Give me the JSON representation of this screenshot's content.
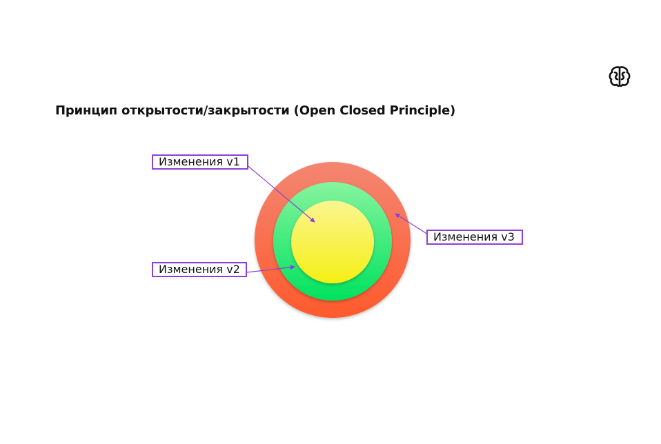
{
  "slide": {
    "title": "Принцип открытости/закрытости (Open Closed Principle)"
  },
  "logo": {
    "icon": "brain-logo-icon"
  },
  "diagram": {
    "circles": [
      {
        "name": "outer",
        "color_top": "#f47e6e",
        "color_bottom": "#ff5a2e"
      },
      {
        "name": "middle",
        "color_top": "#7ef59a",
        "color_bottom": "#00e060"
      },
      {
        "name": "inner",
        "color_top": "#fbf58a",
        "color_bottom": "#f6f018"
      }
    ],
    "labels": {
      "v1": "Изменения v1",
      "v2": "Изменения v2",
      "v3": "Изменения v3"
    },
    "accent": "#8a3fd6"
  }
}
